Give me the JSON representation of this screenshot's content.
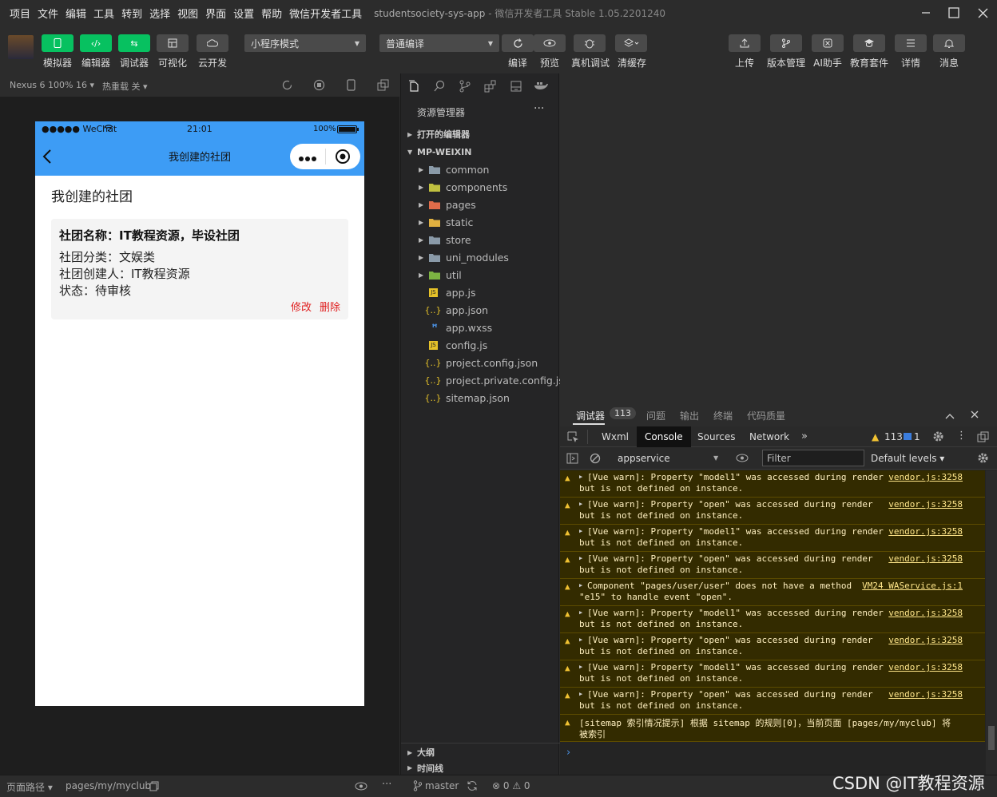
{
  "menu": [
    "项目",
    "文件",
    "编辑",
    "工具",
    "转到",
    "选择",
    "视图",
    "界面",
    "设置",
    "帮助",
    "微信开发者工具"
  ],
  "window_title": "studentsociety-sys-app",
  "window_subtitle": "- 微信开发者工具 Stable 1.05.2201240",
  "toolbar": {
    "left_buttons": [
      "模拟器",
      "编辑器",
      "调试器",
      "可视化",
      "云开发"
    ],
    "mode_select": "小程序模式",
    "compile_select": "普通编译",
    "mid_labels": [
      "编译",
      "预览",
      "真机调试",
      "清缓存"
    ],
    "right_labels": [
      "上传",
      "版本管理",
      "AI助手",
      "教育套件",
      "详情",
      "消息"
    ]
  },
  "sim_bar": {
    "device": "Nexus 6 100% 16 ▾",
    "hot_reload": "热重载 关 ▾"
  },
  "phone": {
    "carrier": "●●●●● WeChat",
    "time": "21:01",
    "battery": "100%",
    "nav_title": "我创建的社团",
    "page_heading": "我创建的社团",
    "card": {
      "name_line": "社团名称：IT教程资源，毕设社团",
      "category_line": "社团分类：文娱类",
      "creator_line": "社团创建人：IT教程资源",
      "status_line": "状态：待审核",
      "edit_label": "修改",
      "delete_label": "删除"
    }
  },
  "explorer": {
    "title": "资源管理器",
    "open_editors": "打开的编辑器",
    "root": "MP-WEIXIN",
    "folders": [
      "common",
      "components",
      "pages",
      "static",
      "store",
      "uni_modules",
      "util"
    ],
    "files": [
      "app.js",
      "app.json",
      "app.wxss",
      "config.js",
      "project.config.json",
      "project.private.config.js...",
      "sitemap.json"
    ],
    "outline": "大纲",
    "timeline": "时间线"
  },
  "devtools": {
    "top_tabs": [
      "调试器",
      "问题",
      "输出",
      "终端",
      "代码质量"
    ],
    "debug_count": "113",
    "console_tabs": [
      "Wxml",
      "Console",
      "Sources",
      "Network"
    ],
    "warn_count": "113",
    "info_count": "1",
    "context": "appservice",
    "filter_placeholder": "Filter",
    "levels": "Default levels ▾",
    "logs": [
      {
        "l1": "[Vue warn]: Property \"model1\" was accessed during render",
        "l2": "but is not defined on instance.",
        "src": "vendor.js:3258"
      },
      {
        "l1": "[Vue warn]: Property \"open\" was accessed during render",
        "l2": "but is not defined on instance.",
        "src": "vendor.js:3258"
      },
      {
        "l1": "[Vue warn]: Property \"model1\" was accessed during render",
        "l2": "but is not defined on instance.",
        "src": "vendor.js:3258"
      },
      {
        "l1": "[Vue warn]: Property \"open\" was accessed during render",
        "l2": "but is not defined on instance.",
        "src": "vendor.js:3258"
      },
      {
        "l1": "Component \"pages/user/user\" does not have a method",
        "l2": "\"e15\" to handle event \"open\".",
        "src": "VM24 WAService.js:1"
      },
      {
        "l1": "[Vue warn]: Property \"model1\" was accessed during render",
        "l2": "but is not defined on instance.",
        "src": "vendor.js:3258"
      },
      {
        "l1": "[Vue warn]: Property \"open\" was accessed during render",
        "l2": "but is not defined on instance.",
        "src": "vendor.js:3258"
      },
      {
        "l1": "[Vue warn]: Property \"model1\" was accessed during render",
        "l2": "but is not defined on instance.",
        "src": "vendor.js:3258"
      },
      {
        "l1": "[Vue warn]: Property \"open\" was accessed during render",
        "l2": "but is not defined on instance.",
        "src": "vendor.js:3258"
      }
    ],
    "sitemap_l1": "[sitemap 索引情况提示] 根据 sitemap 的规则[0]，当前页面 [pages/my/myclub] 将",
    "sitemap_l2": "被索引"
  },
  "footer": {
    "path_label": "页面路径 ▾",
    "path": "pages/my/myclub",
    "branch": "master",
    "errors": "⊗ 0 ⚠ 0"
  },
  "watermark": "CSDN @IT教程资源",
  "colors": {
    "accent_green": "#07c160",
    "phone_nav": "#3d9cf5",
    "warn_bg": "#332b00",
    "delete_red": "#e02020"
  }
}
